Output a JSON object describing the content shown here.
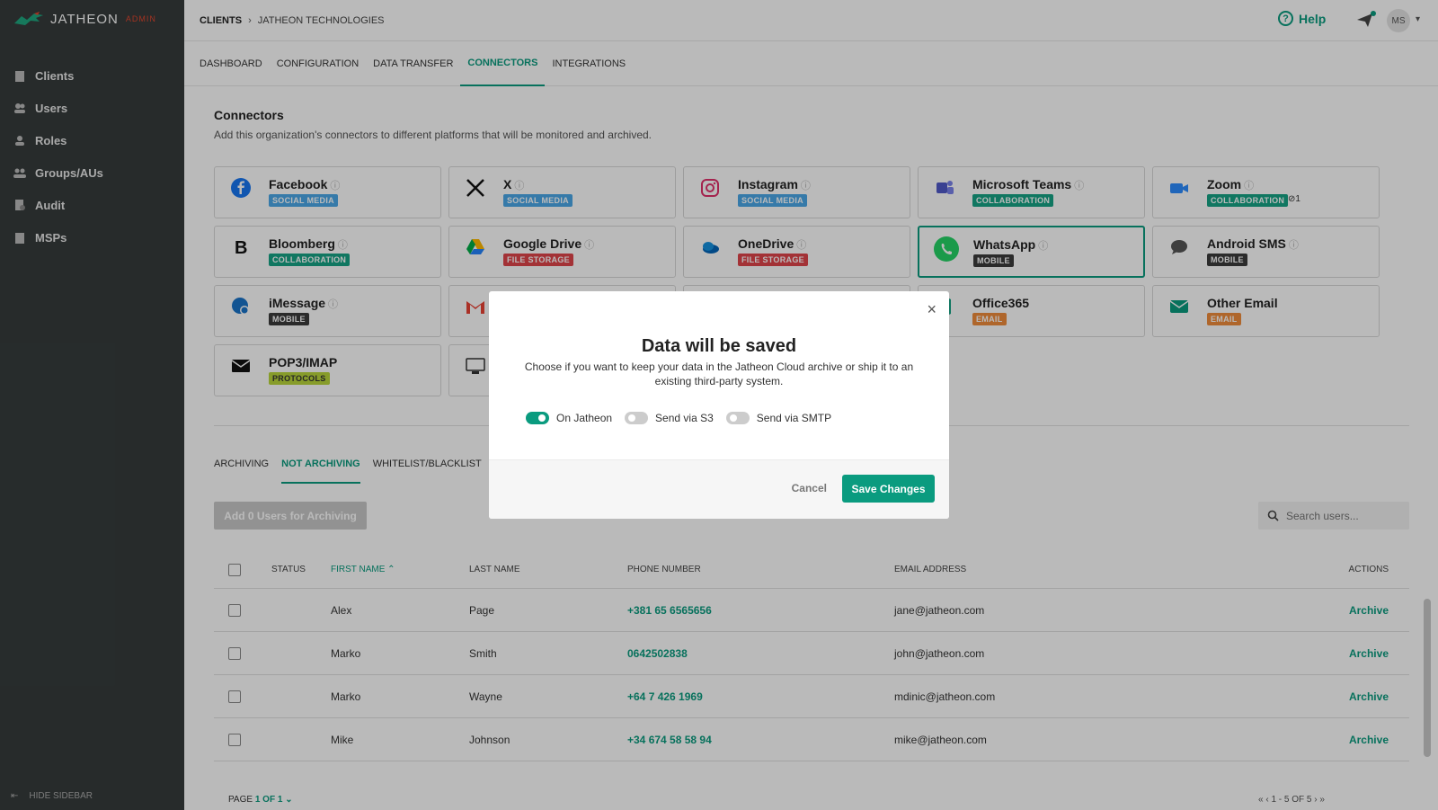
{
  "brand": {
    "name": "JATHEON",
    "tag": "ADMIN"
  },
  "sidebar": {
    "items": [
      {
        "label": "Clients",
        "icon": "building-icon"
      },
      {
        "label": "Users",
        "icon": "users-icon"
      },
      {
        "label": "Roles",
        "icon": "roles-icon"
      },
      {
        "label": "Groups/AUs",
        "icon": "groups-icon"
      },
      {
        "label": "Audit",
        "icon": "audit-icon"
      },
      {
        "label": "MSPs",
        "icon": "building-icon"
      }
    ],
    "hide_label": "HIDE SIDEBAR"
  },
  "header": {
    "crumb_root": "CLIENTS",
    "crumb_current": "JATHEON TECHNOLOGIES",
    "help_label": "Help",
    "avatar_initials": "MS"
  },
  "tabs": [
    "DASHBOARD",
    "CONFIGURATION",
    "DATA TRANSFER",
    "CONNECTORS",
    "INTEGRATIONS"
  ],
  "active_tab": "CONNECTORS",
  "connectors": {
    "title": "Connectors",
    "subtitle": "Add this organization's connectors to different platforms that will be monitored and archived.",
    "cards": [
      {
        "name": "Facebook",
        "tag": "SOCIAL MEDIA",
        "icon": "facebook-icon"
      },
      {
        "name": "X",
        "tag": "SOCIAL MEDIA",
        "icon": "x-icon"
      },
      {
        "name": "Instagram",
        "tag": "SOCIAL MEDIA",
        "icon": "instagram-icon"
      },
      {
        "name": "Microsoft Teams",
        "tag": "COLLABORATION",
        "icon": "teams-icon"
      },
      {
        "name": "Zoom",
        "tag": "COLLABORATION",
        "icon": "zoom-icon",
        "link_count": "1"
      },
      {
        "name": "Bloomberg",
        "tag": "COLLABORATION",
        "icon": "bloomberg-icon"
      },
      {
        "name": "Google Drive",
        "tag": "FILE STORAGE",
        "icon": "google-drive-icon"
      },
      {
        "name": "OneDrive",
        "tag": "FILE STORAGE",
        "icon": "onedrive-icon"
      },
      {
        "name": "WhatsApp",
        "tag": "MOBILE",
        "icon": "whatsapp-icon"
      },
      {
        "name": "Android SMS",
        "tag": "MOBILE",
        "icon": "sms-icon"
      },
      {
        "name": "iMessage",
        "tag": "MOBILE",
        "icon": "imessage-icon"
      },
      {
        "name": "",
        "tag": "",
        "icon": "gmail-icon"
      },
      {
        "name": "",
        "tag": "",
        "icon": ""
      },
      {
        "name": "Office365",
        "tag": "EMAIL",
        "icon": "office365-icon"
      },
      {
        "name": "Other Email",
        "tag": "EMAIL",
        "icon": "email-icon"
      },
      {
        "name": "POP3/IMAP",
        "tag": "PROTOCOLS",
        "icon": "envelope-icon"
      },
      {
        "name": "",
        "tag": "",
        "icon": "sftp-icon"
      }
    ]
  },
  "subtabs": [
    "ARCHIVING",
    "NOT ARCHIVING",
    "WHITELIST/BLACKLIST"
  ],
  "active_subtab": "NOT ARCHIVING",
  "add_button": "Add 0 Users for Archiving",
  "search": {
    "placeholder": "Search users..."
  },
  "table": {
    "headers": {
      "status": "STATUS",
      "first": "FIRST NAME",
      "last": "LAST NAME",
      "phone": "PHONE NUMBER",
      "email": "EMAIL ADDRESS",
      "actions": "ACTIONS"
    },
    "rows": [
      {
        "first": "Alex",
        "last": "Page",
        "phone": "+381 65 6565656",
        "email": "jane@jatheon.com",
        "action": "Archive"
      },
      {
        "first": "Marko",
        "last": "Smith",
        "phone": "0642502838",
        "email": "john@jatheon.com",
        "action": "Archive"
      },
      {
        "first": "Marko",
        "last": "Wayne",
        "phone": "+64 7 426 1969",
        "email": "mdinic@jatheon.com",
        "action": "Archive"
      },
      {
        "first": "Mike",
        "last": "Johnson",
        "phone": "+34 674 58 58 94",
        "email": "mike@jatheon.com",
        "action": "Archive"
      }
    ]
  },
  "pager": {
    "label": "PAGE",
    "value": "1 OF 1",
    "range": "1 - 5 OF 5"
  },
  "modal": {
    "title": "Data will be saved",
    "description": "Choose if you want to keep your data in the Jatheon Cloud archive or ship it to an existing third-party system.",
    "options": [
      {
        "label": "On Jatheon",
        "on": true
      },
      {
        "label": "Send via S3",
        "on": false
      },
      {
        "label": "Send via SMTP",
        "on": false
      }
    ],
    "cancel_label": "Cancel",
    "save_label": "Save Changes"
  },
  "colors": {
    "accent": "#0a9b7f",
    "sidebar": "#363c3c",
    "brand_red": "#e0452e"
  }
}
